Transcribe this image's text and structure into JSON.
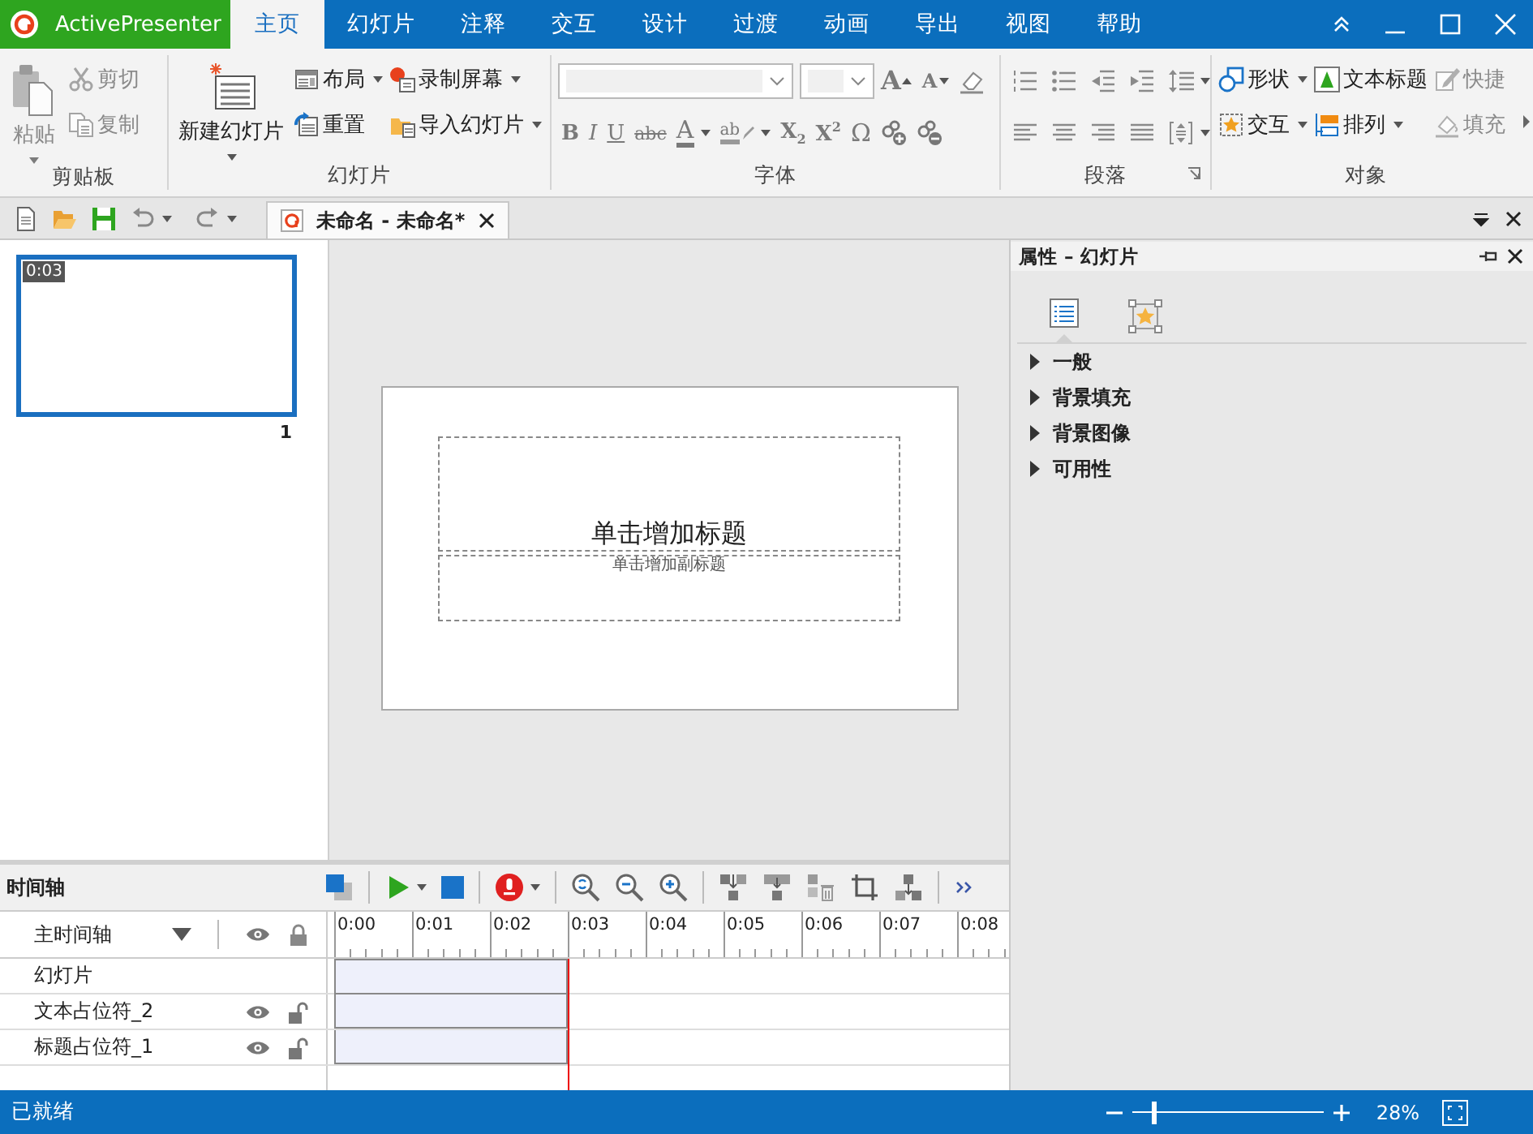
{
  "app_button": {
    "label": "ActivePresenter"
  },
  "ribbon_tabs": [
    {
      "label": "主页",
      "selected": true
    },
    {
      "label": "幻灯片",
      "selected": false
    },
    {
      "label": "注释",
      "selected": false
    },
    {
      "label": "交互",
      "selected": false
    },
    {
      "label": "设计",
      "selected": false
    },
    {
      "label": "过渡",
      "selected": false
    },
    {
      "label": "动画",
      "selected": false
    },
    {
      "label": "导出",
      "selected": false
    },
    {
      "label": "视图",
      "selected": false
    },
    {
      "label": "帮助",
      "selected": false
    }
  ],
  "ribbon_groups": [
    {
      "title": "剪贴板",
      "columns": [
        [
          {
            "kind": "large",
            "label": "粘贴",
            "dropdown": true,
            "disabled": true
          }
        ],
        [
          {
            "kind": "small",
            "label": "剪切",
            "dropdown": false,
            "disabled": true
          },
          {
            "kind": "small",
            "label": "复制",
            "dropdown": false,
            "disabled": true
          }
        ]
      ]
    },
    {
      "title": "幻灯片",
      "columns": [
        [
          {
            "kind": "large",
            "label": "新建幻灯片",
            "dropdown": true,
            "disabled": false
          }
        ],
        [
          {
            "kind": "small",
            "label": "布局",
            "dropdown": true,
            "disabled": false
          },
          {
            "kind": "small",
            "label": "重置",
            "dropdown": false,
            "disabled": false
          }
        ],
        [
          {
            "kind": "small",
            "label": "录制屏幕",
            "dropdown": true,
            "disabled": false
          },
          {
            "kind": "small",
            "label": "导入幻灯片",
            "dropdown": true,
            "disabled": false
          }
        ]
      ]
    },
    {
      "title": "字体",
      "rows": [
        [
          {
            "kind": "combo"
          },
          {
            "kind": "combo"
          },
          {
            "kind": "glyph",
            "glyph": "A",
            "dropdown": false
          },
          {
            "kind": "glyph",
            "glyph": "A",
            "dropdown": false
          },
          {
            "kind": "icon",
            "dropdown": false
          }
        ],
        [
          {
            "kind": "glyph",
            "glyph": "B",
            "dropdown": false
          },
          {
            "kind": "glyph",
            "glyph": "I",
            "dropdown": false
          },
          {
            "kind": "glyph",
            "glyph": "U",
            "dropdown": false
          },
          {
            "kind": "glyph",
            "glyph": "abc",
            "dropdown": false
          },
          {
            "kind": "glyph",
            "glyph": "A",
            "dropdown": true
          },
          {
            "kind": "glyph",
            "glyph": "ab",
            "dropdown": true
          },
          {
            "kind": "glyph",
            "glyph": "X$_{2}$",
            "dropdown": false
          },
          {
            "kind": "glyph",
            "glyph": "X$^{2}$",
            "dropdown": false
          },
          {
            "kind": "glyph",
            "glyph": "Ω",
            "dropdown": false
          },
          {
            "kind": "icon",
            "dropdown": false
          },
          {
            "kind": "icon",
            "dropdown": false
          }
        ]
      ]
    },
    {
      "title": "段落",
      "rows": [
        [
          {
            "kind": "icon",
            "dropdown": false
          },
          {
            "kind": "icon",
            "dropdown": false
          },
          {
            "kind": "icon",
            "dropdown": false
          },
          {
            "kind": "icon",
            "dropdown": false
          },
          {
            "kind": "icon",
            "dropdown": true
          }
        ],
        [
          {
            "kind": "icon",
            "dropdown": false
          },
          {
            "kind": "icon",
            "dropdown": false
          },
          {
            "kind": "icon",
            "dropdown": false
          },
          {
            "kind": "icon",
            "dropdown": false
          },
          {
            "kind": "icon",
            "dropdown": true
          }
        ]
      ]
    },
    {
      "title": "对象",
      "columns": [
        [
          {
            "kind": "small",
            "label": "形状",
            "dropdown": true,
            "disabled": false
          },
          {
            "kind": "small",
            "label": "交互",
            "dropdown": true,
            "disabled": false
          }
        ],
        [
          {
            "kind": "small",
            "label": "文本标题",
            "dropdown": false,
            "disabled": false
          },
          {
            "kind": "small",
            "label": "排列",
            "dropdown": true,
            "disabled": false
          }
        ],
        [
          {
            "kind": "small",
            "label": "快捷",
            "dropdown": false,
            "disabled": true
          },
          {
            "kind": "small",
            "label": "填充",
            "dropdown": false,
            "disabled": true
          }
        ]
      ]
    }
  ],
  "document_tabs": [
    {
      "label": "未命名 - 未命名*",
      "selected": true
    }
  ],
  "slides": [
    {
      "duration": "0:03",
      "number": "1",
      "selected": true
    }
  ],
  "slide_canvas": {
    "title_placeholder": "单击增加标题",
    "subtitle_placeholder": "单击增加副标题"
  },
  "properties": {
    "title": "属性 – 幻灯片",
    "tabs": [
      {
        "selected": true
      },
      {
        "selected": false
      }
    ],
    "sections": [
      {
        "label": "一般",
        "expanded": false
      },
      {
        "label": "背景填充",
        "expanded": false
      },
      {
        "label": "背景图像",
        "expanded": false
      },
      {
        "label": "可用性",
        "expanded": false
      }
    ]
  },
  "timeline": {
    "title": "时间轴",
    "main_track": "主时间轴",
    "ruler": [
      "0:00",
      "0:01",
      "0:02",
      "0:03",
      "0:04",
      "0:05",
      "0:06",
      "0:07",
      "0:08"
    ],
    "tracks": [
      {
        "kind": "slide",
        "label": "幻灯片"
      },
      {
        "kind": "object",
        "label": "文本占位符_2",
        "visible": true,
        "locked": false
      },
      {
        "kind": "object",
        "label": "标题占位符_1",
        "visible": true,
        "locked": false
      }
    ]
  },
  "status_bar": {
    "text": "已就绪",
    "zoom": {
      "level": 0.1,
      "reading": "28%"
    }
  }
}
